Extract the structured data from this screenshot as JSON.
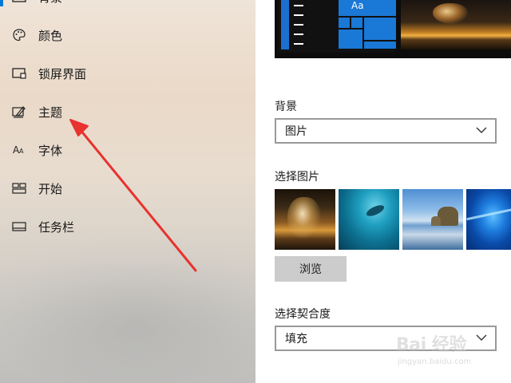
{
  "nav": {
    "items": [
      {
        "label": "背景",
        "icon": "picture-icon",
        "active": true
      },
      {
        "label": "颜色",
        "icon": "palette-icon",
        "active": false
      },
      {
        "label": "锁屏界面",
        "icon": "lock-screen-icon",
        "active": false
      },
      {
        "label": "主题",
        "icon": "theme-brush-icon",
        "active": false
      },
      {
        "label": "字体",
        "icon": "font-icon",
        "active": false
      },
      {
        "label": "开始",
        "icon": "start-tiles-icon",
        "active": false
      },
      {
        "label": "任务栏",
        "icon": "taskbar-icon",
        "active": false
      }
    ]
  },
  "preview": {
    "tile_label": "Aa"
  },
  "background": {
    "label": "背景",
    "value": "图片"
  },
  "choose_picture": {
    "label": "选择图片",
    "browse_label": "浏览"
  },
  "fit": {
    "label": "选择契合度",
    "value": "填充"
  },
  "watermark": {
    "main": "Bai 经验",
    "sub": "jingyan.baidu.com"
  },
  "colors": {
    "accent": "#0078d7",
    "annotation_arrow": "#e8322e"
  }
}
